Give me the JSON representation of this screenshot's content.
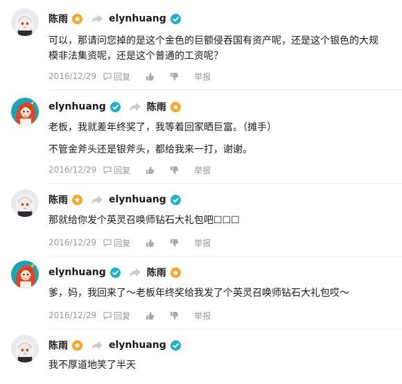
{
  "users": {
    "chenyu": {
      "name": "陈雨",
      "badge_color": "#f5a623"
    },
    "elyn": {
      "name": "elynhuang",
      "badge_color": "#21b1c6"
    }
  },
  "labels": {
    "reply": "回复",
    "report": "举报"
  },
  "icons": [
    "reply-icon",
    "thumbs-up-icon",
    "thumbs-down-icon",
    "share-arrow-icon",
    "verified-badge-icon"
  ],
  "comments": [
    {
      "author": "陈雨",
      "author_badge": "orange",
      "reply_to": "elynhuang",
      "reply_to_badge": "teal",
      "lines": [
        "可以，那请问您掉的是这个金色的巨额侵吞国有资产呢，还是这个银色的大规模非法集资呢，还是这个普通的工资呢？"
      ],
      "date": "2016/12/29"
    },
    {
      "author": "elynhuang",
      "author_badge": "teal",
      "reply_to": "陈雨",
      "reply_to_badge": "orange",
      "lines": [
        "老板，我就差年终奖了，我等着回家晒巨富。（摊手）",
        "不管金斧头还是银斧头，都给我来一打，谢谢。"
      ],
      "date": "2016/12/29"
    },
    {
      "author": "陈雨",
      "author_badge": "orange",
      "reply_to": "elynhuang",
      "reply_to_badge": "teal",
      "lines": [
        "那就给你发个英灵召唤师钻石大礼包吧☐☐☐"
      ],
      "date": "2016/12/29"
    },
    {
      "author": "elynhuang",
      "author_badge": "teal",
      "reply_to": "陈雨",
      "reply_to_badge": "orange",
      "lines": [
        "爹，妈，我回来了～老板年终奖给我发了个英灵召唤师钻石大礼包哎～"
      ],
      "date": "2016/12/29"
    },
    {
      "author": "陈雨",
      "author_badge": "orange",
      "reply_to": "elynhuang",
      "reply_to_badge": "teal",
      "lines": [
        "我不厚道地笑了半天"
      ],
      "date": ""
    }
  ]
}
